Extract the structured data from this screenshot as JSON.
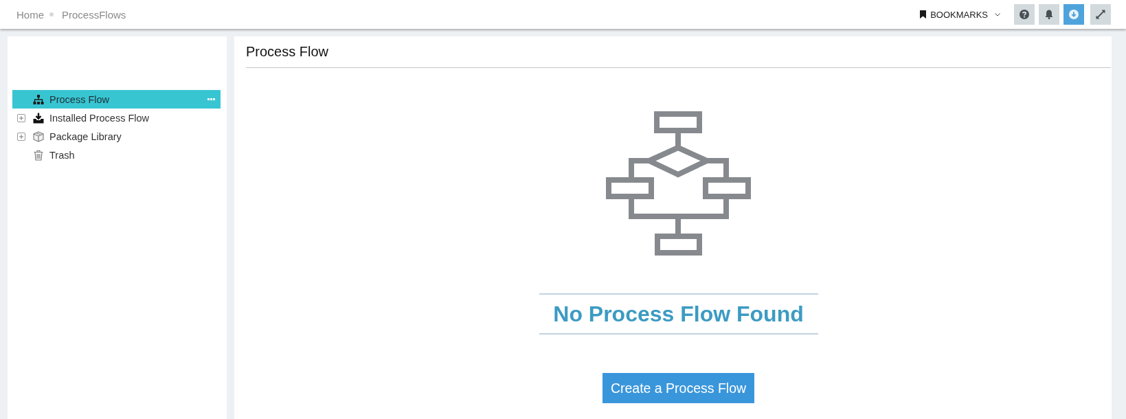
{
  "breadcrumb": [
    {
      "label": "Home"
    },
    {
      "label": "ProcessFlows"
    }
  ],
  "toolbar": {
    "bookmarks": "BOOKMARKS",
    "buttons": [
      {
        "kind": "help",
        "highlighted": false
      },
      {
        "kind": "bell",
        "highlighted": false
      },
      {
        "kind": "download",
        "highlighted": true
      },
      {
        "kind": "expand",
        "highlighted": false
      }
    ]
  },
  "sidebar": {
    "items": [
      {
        "label": "Process Flow",
        "kind": "sitemap",
        "selected": true,
        "expandable": false
      },
      {
        "label": "Installed Process Flow",
        "kind": "install",
        "selected": false,
        "expandable": true
      },
      {
        "label": "Package Library",
        "kind": "package",
        "selected": false,
        "expandable": true
      },
      {
        "label": "Trash",
        "kind": "trash",
        "selected": false,
        "expandable": false
      }
    ]
  },
  "main": {
    "title": "Process Flow",
    "empty_state": {
      "heading": "No Process Flow Found",
      "button": "Create a Process Flow"
    }
  }
}
